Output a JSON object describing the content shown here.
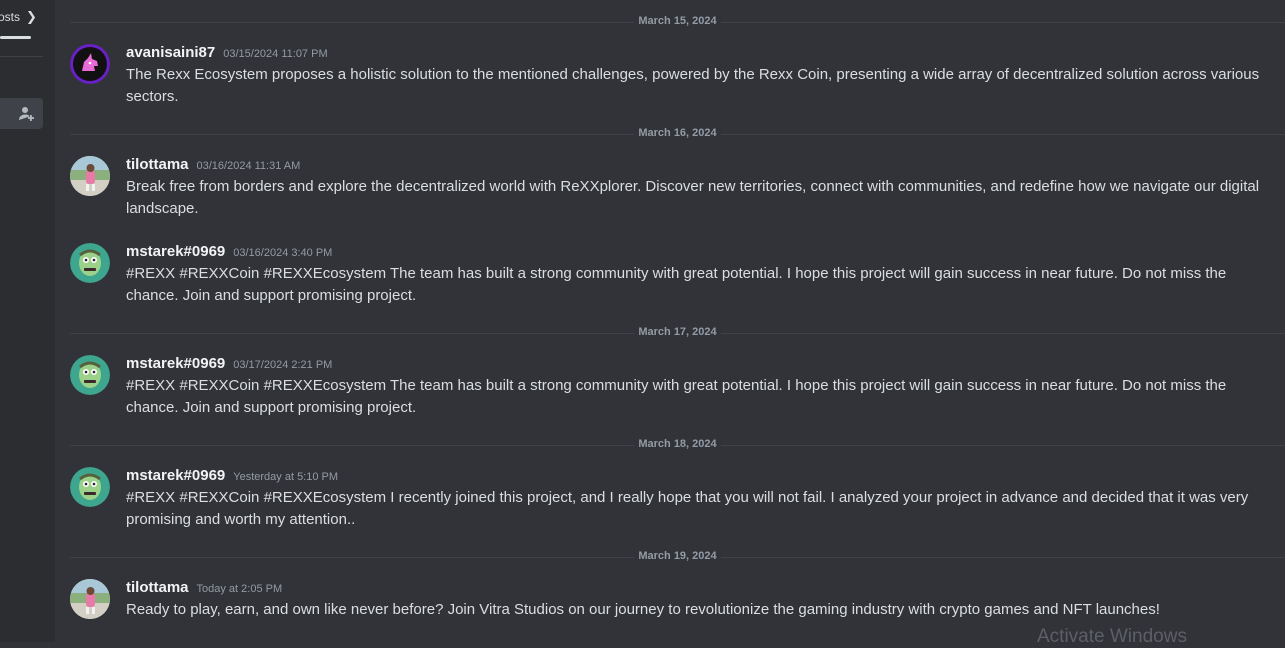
{
  "sidebar": {
    "posts_label": "osts",
    "fragment": "t"
  },
  "dividers": [
    "March 15, 2024",
    "March 16, 2024",
    "March 17, 2024",
    "March 18, 2024",
    "March 19, 2024"
  ],
  "messages": [
    {
      "user": "avanisaini87",
      "time": "03/15/2024 11:07 PM",
      "avatar": "unicorn",
      "text": "The Rexx Ecosystem proposes a holistic solution to the mentioned challenges, powered by the Rexx Coin, presenting a wide array of decentralized solution across various sectors."
    },
    {
      "user": "tilottama",
      "time": "03/16/2024 11:31 AM",
      "avatar": "photo",
      "text": "Break free from borders and explore the decentralized world with ReXXplorer. Discover new territories, connect with communities, and redefine how we navigate our digital landscape."
    },
    {
      "user": "mstarek#0969",
      "time": "03/16/2024 3:40 PM",
      "avatar": "zombie",
      "text": "#REXX #REXXCoin #REXXEcosystem  The team has built a strong community with great potential. I hope this project will gain success in near future. Do not miss the chance. Join and support promising project."
    },
    {
      "user": "mstarek#0969",
      "time": "03/17/2024 2:21 PM",
      "avatar": "zombie",
      "text": "#REXX #REXXCoin #REXXEcosystem  The team has built a strong community with great potential. I hope this project will gain success in near future. Do not miss the chance. Join and support promising project."
    },
    {
      "user": "mstarek#0969",
      "time": "Yesterday at 5:10 PM",
      "avatar": "zombie",
      "text": "#REXX #REXXCoin #REXXEcosystem    I recently joined this project, and I really hope that you will not fail. I analyzed your project in advance and decided that it was very promising and worth my attention.."
    },
    {
      "user": "tilottama",
      "time": "Today at 2:05 PM",
      "avatar": "photo",
      "text": "Ready to play, earn, and own like never before? Join Vitra Studios on our journey to revolutionize the gaming industry with crypto games and NFT launches!"
    }
  ],
  "watermark": "Activate Windows",
  "colors": {
    "background": "#313338",
    "sidebar": "#2b2d31",
    "username": "#f2f3f5",
    "text": "#dbdee1",
    "muted": "#949ba4"
  }
}
